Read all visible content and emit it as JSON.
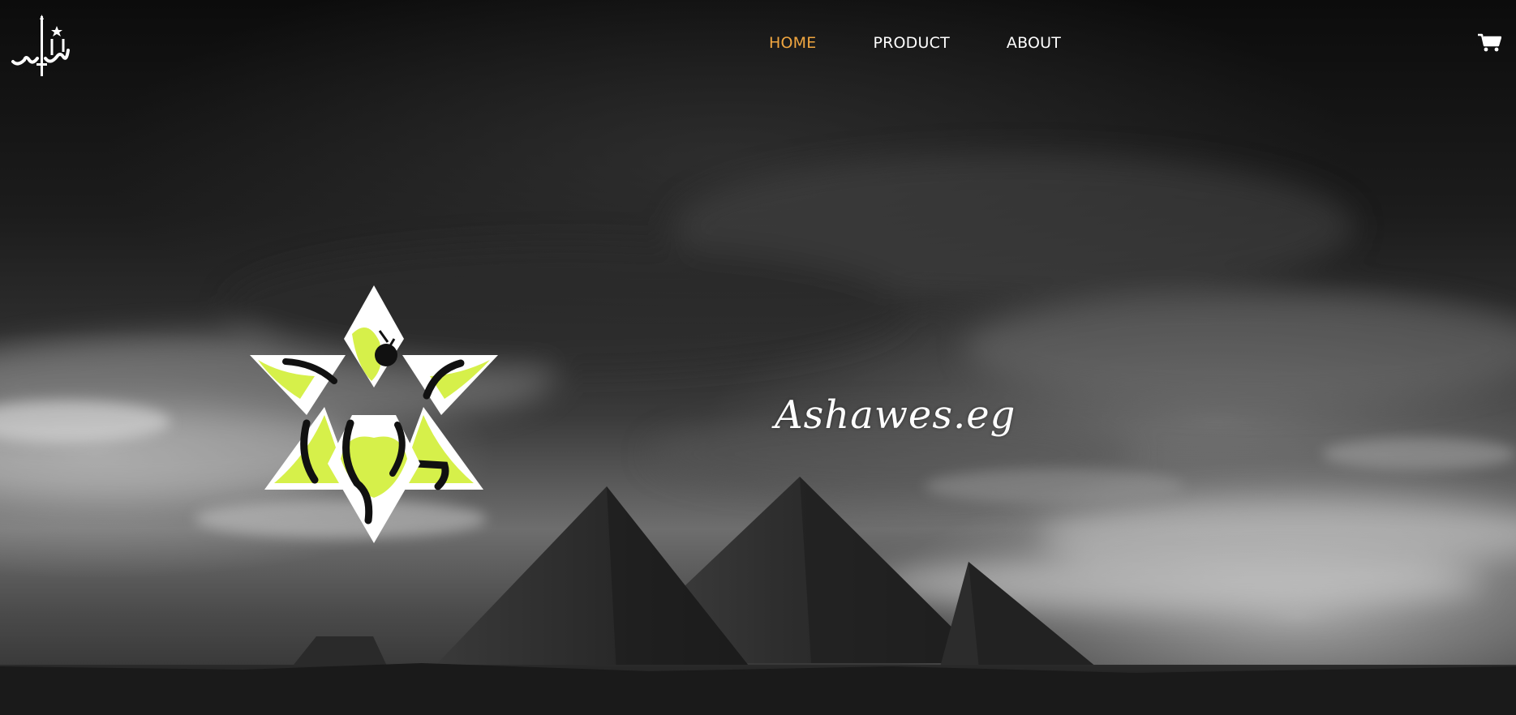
{
  "nav": {
    "items": [
      {
        "label": "HOME",
        "active": true
      },
      {
        "label": "PRODUCT",
        "active": false
      },
      {
        "label": "ABOUT",
        "active": false
      }
    ]
  },
  "icons": {
    "logo": "ashawes-arabic-logo",
    "cart": "cart-icon",
    "emblem": "star-emblem-logo"
  },
  "hero": {
    "title": "Ashawes.eg"
  },
  "colors": {
    "nav_active": "#f0a640",
    "nav_text": "#ffffff",
    "emblem_accent": "#d6f04a"
  }
}
